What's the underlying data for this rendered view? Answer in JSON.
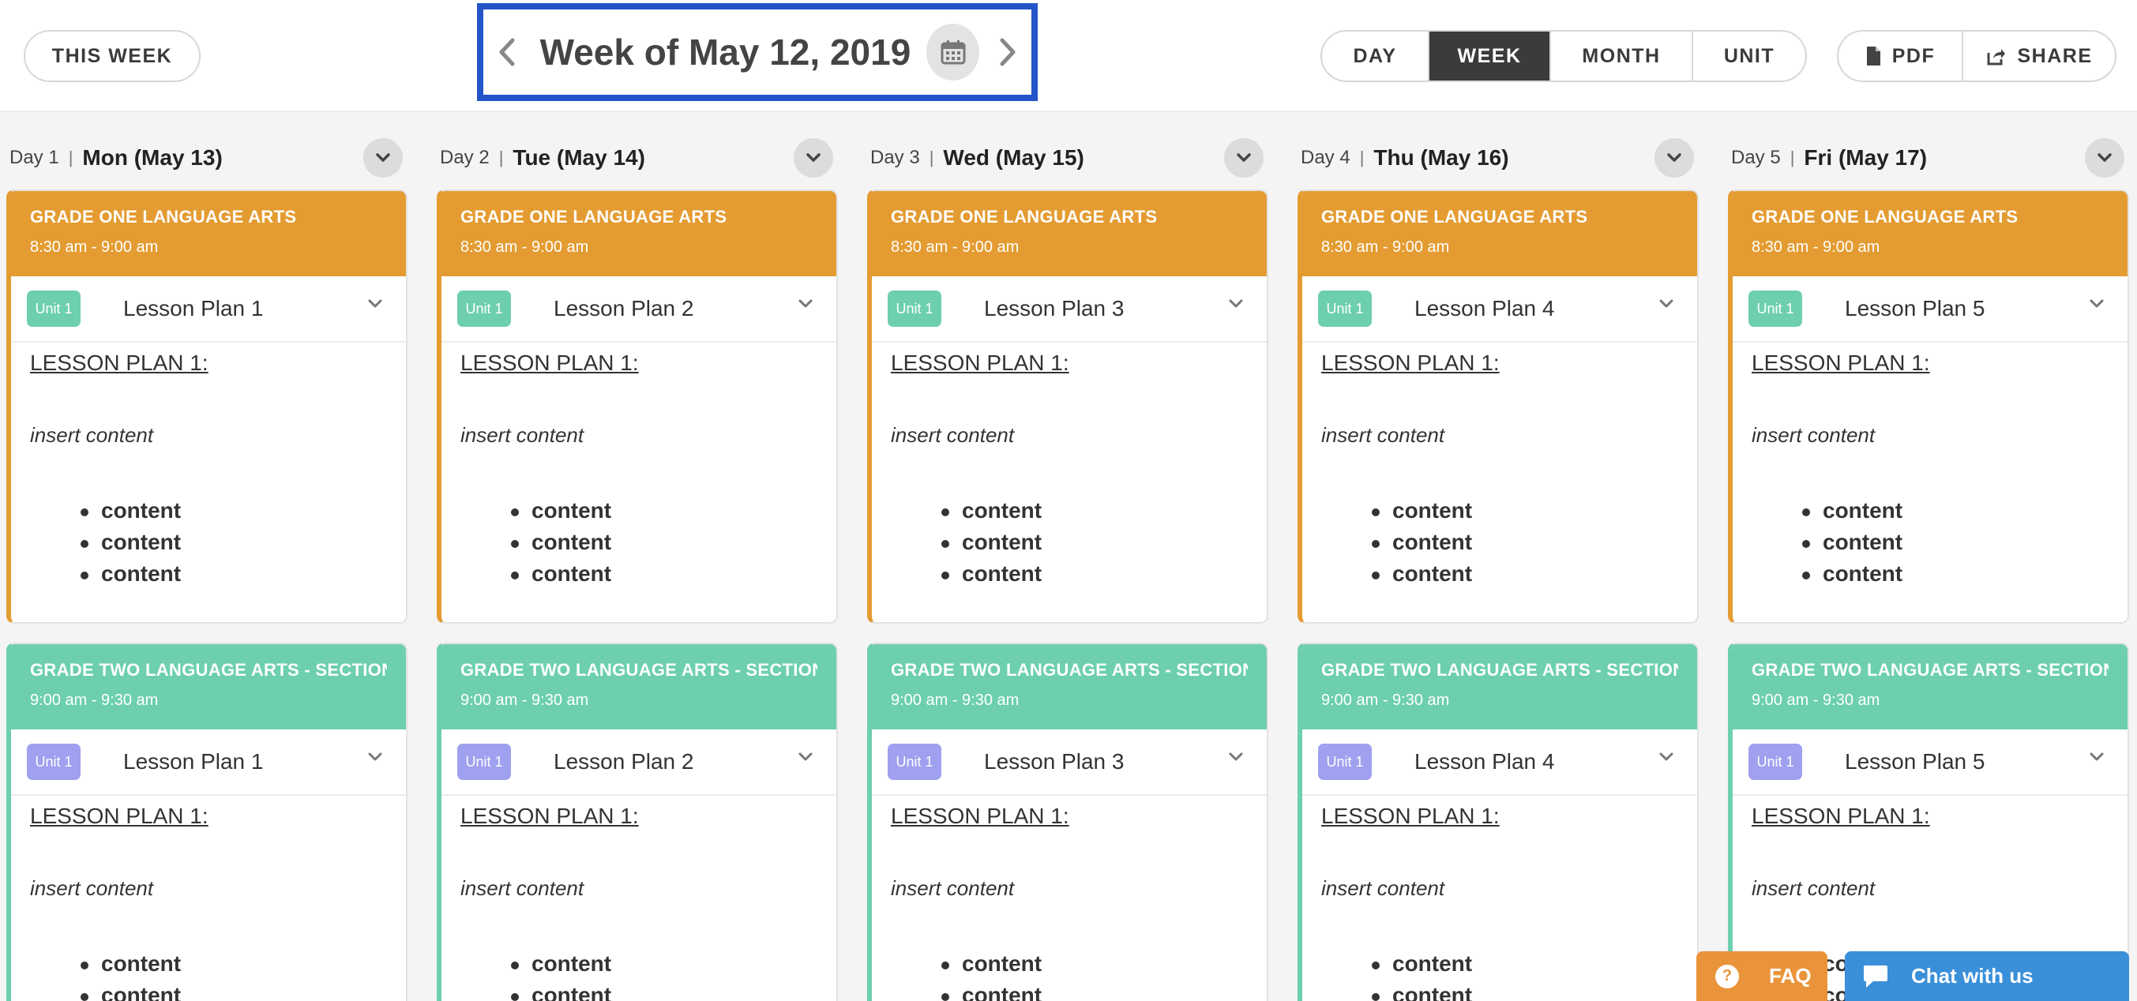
{
  "header": {
    "this_week_label": "THIS WEEK",
    "week_title": "Week of May 12, 2019",
    "views": [
      {
        "label": "DAY",
        "active": false
      },
      {
        "label": "WEEK",
        "active": true
      },
      {
        "label": "MONTH",
        "active": false
      },
      {
        "label": "UNIT",
        "active": false
      }
    ],
    "export": [
      {
        "label": "PDF",
        "icon": "document-icon"
      },
      {
        "label": "SHARE",
        "icon": "share-icon"
      }
    ]
  },
  "days": [
    {
      "num": "Day 1",
      "date": "Mon (May 13)"
    },
    {
      "num": "Day 2",
      "date": "Tue (May 14)"
    },
    {
      "num": "Day 3",
      "date": "Wed (May 15)"
    },
    {
      "num": "Day 4",
      "date": "Thu (May 16)"
    },
    {
      "num": "Day 5",
      "date": "Fri (May 17)"
    }
  ],
  "classes": [
    {
      "title": "GRADE ONE LANGUAGE ARTS",
      "time": "8:30 am - 9:00 am",
      "color": "#e49c32",
      "unit": "Unit 1",
      "unit_color": "#6dcfb0",
      "lessons": [
        "Lesson Plan 1",
        "Lesson Plan 2",
        "Lesson Plan 3",
        "Lesson Plan 4",
        "Lesson Plan 5"
      ]
    },
    {
      "title": "GRADE TWO LANGUAGE ARTS - SECTION I",
      "time": "9:00 am - 9:30 am",
      "color": "#6dcfb0",
      "unit": "Unit 1",
      "unit_color": "#9fa0ef",
      "lessons": [
        "Lesson Plan 1",
        "Lesson Plan 2",
        "Lesson Plan 3",
        "Lesson Plan 4",
        "Lesson Plan 5"
      ]
    }
  ],
  "lesson_content": {
    "heading": "LESSON PLAN 1:",
    "insert": "insert content",
    "bullets": [
      "content",
      "content",
      "content"
    ]
  },
  "footer": {
    "faq_label": "FAQ",
    "faq_icon_glyph": "?",
    "chat_label": "Chat with us"
  },
  "colors": {
    "accent_blue": "#2354c8",
    "orange": "#e49c32",
    "teal": "#6dcfb0",
    "purple": "#9fa0ef",
    "chat_blue": "#3a8fd9"
  }
}
